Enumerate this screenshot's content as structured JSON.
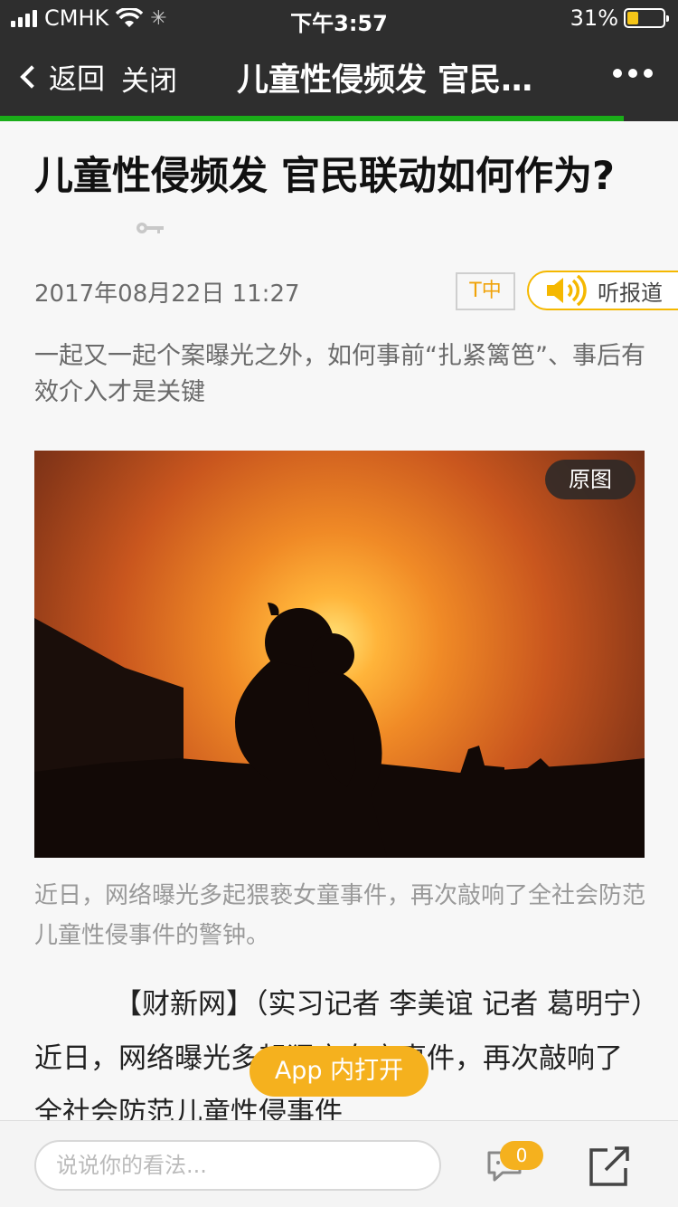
{
  "status_bar": {
    "carrier": "CMHK",
    "time": "下午3:57",
    "battery_percent": "31%",
    "battery_level": 0.31
  },
  "nav": {
    "back_label": "返回",
    "close_label": "关闭",
    "title": "儿童性侵频发 官民…",
    "progress": 0.92
  },
  "article": {
    "headline": "儿童性侵频发 官民联动如何作为?",
    "date": "2017年08月22日 11:27",
    "font_size_button": "T中",
    "listen_label": "听报道",
    "summary": "一起又一起个案曝光之外，如何事前“扎紧篱笆”、事后有效介入才是关键",
    "original_image_label": "原图",
    "caption": "近日，网络曝光多起猥亵女童事件，再次敲响了全社会防范儿童性侵事件的警钟。",
    "body": "【财新网】（实习记者 李美谊 记者 葛明宁）近日，网络曝光多起猥亵女童事件，再次敲响了全社会防范儿童性侵事件"
  },
  "app_open_label": "App 内打开",
  "bottom_bar": {
    "comment_placeholder": "说说你的看法...",
    "comment_count": "0"
  },
  "colors": {
    "nav_background": "#2e2e2e",
    "progress_green": "#1aad19",
    "accent_orange": "#f5b11e"
  }
}
